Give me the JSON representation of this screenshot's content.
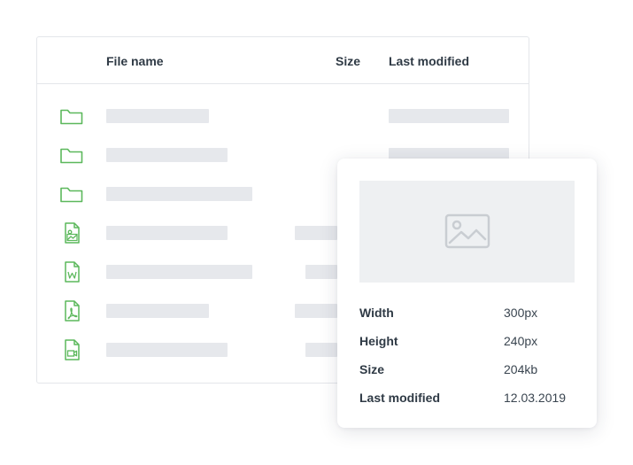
{
  "colors": {
    "icon_accent": "#5cb85c",
    "placeholder": "#e6e8ec",
    "border": "#e4e6ea"
  },
  "file_table": {
    "columns": {
      "name": "File name",
      "size": "Size",
      "modified": "Last modified"
    },
    "rows": [
      {
        "icon": "folder-icon"
      },
      {
        "icon": "folder-icon"
      },
      {
        "icon": "folder-icon"
      },
      {
        "icon": "image-file-icon"
      },
      {
        "icon": "word-file-icon"
      },
      {
        "icon": "pdf-file-icon"
      },
      {
        "icon": "video-file-icon"
      }
    ]
  },
  "details": {
    "preview_icon": "image-icon",
    "properties": [
      {
        "label": "Width",
        "value": "300px"
      },
      {
        "label": "Height",
        "value": "240px"
      },
      {
        "label": "Size",
        "value": "204kb"
      },
      {
        "label": "Last modified",
        "value": "12.03.2019"
      }
    ]
  }
}
